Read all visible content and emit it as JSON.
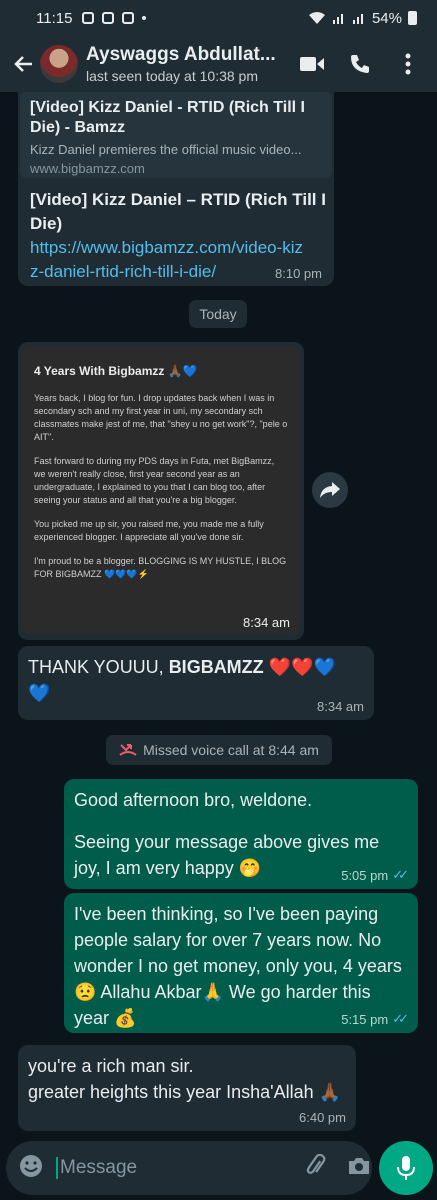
{
  "status_bar": {
    "time": "11:15",
    "battery": "54%"
  },
  "header": {
    "contact_name": "Ayswaggs Abdullat...",
    "last_seen": "last seen today at 10:38 pm"
  },
  "messages": {
    "link_preview": {
      "title": "[Video] Kizz Daniel - RTID (Rich Till I Die) - Bamzz",
      "description": "Kizz Daniel premieres the official music video...",
      "domain": "www.bigbamzz.com"
    },
    "link_message": {
      "title": "[Video] Kizz Daniel – RTID (Rich Till I Die)",
      "url": "https://www.bigbamzz.com/video-kizz-daniel-rtid-rich-till-i-die/",
      "time": "8:10 pm"
    },
    "date_divider": "Today",
    "image_message": {
      "title": "4 Years With Bigbamzz 🙏🏾💙",
      "paragraphs": [
        "Years back, I blog for fun. I drop updates back when I was in secondary sch and my first year in uni, my secondary sch classmates make jest of me, that \"shey u no get work\"?, \"pele o AIT\".",
        "Fast forward to during my PDS days in Futa, met BigBamzz, we weren't really close, first year second year as an undergraduate, I explained to you that I can blog too, after seeing your status and all that you're a big blogger.",
        "You picked me up sir, you raised me, you made me a fully experienced blogger. I appreciate all you've done sir.",
        "I'm proud to be a blogger. BLOGGING IS MY HUSTLE, I BLOG FOR BIGBAMZZ 💙💙💙⚡"
      ],
      "time": "8:34 am"
    },
    "thanks_message": {
      "text_plain": "THANK YOUUU, ",
      "text_bold": "BIGBAMZZ",
      "emojis": "❤️❤️💙 💙",
      "time": "8:34 am"
    },
    "missed_call": "Missed voice call at 8:44 am",
    "out_message_1": {
      "line1": "Good afternoon bro, weldone.",
      "line2": "Seeing your message above gives me joy, I am very happy 🤭",
      "time": "5:05 pm"
    },
    "out_message_2": {
      "text": "I've been thinking, so I've been paying people salary for over 7 years now. No wonder I no get money, only you, 4 years 😟 Allahu Akbar🙏 We go harder this year 💰",
      "time": "5:15 pm"
    },
    "in_message_last": {
      "line1": "you're a rich man sir.",
      "line2": "greater heights this year Insha'Allah 🙏🏾",
      "time": "6:40 pm"
    }
  },
  "input": {
    "placeholder": "Message"
  },
  "colors": {
    "background": "#0b141a",
    "incoming_bubble": "#1f2c34",
    "outgoing_bubble": "#005c4b",
    "accent": "#00a884",
    "link": "#53bdeb"
  }
}
